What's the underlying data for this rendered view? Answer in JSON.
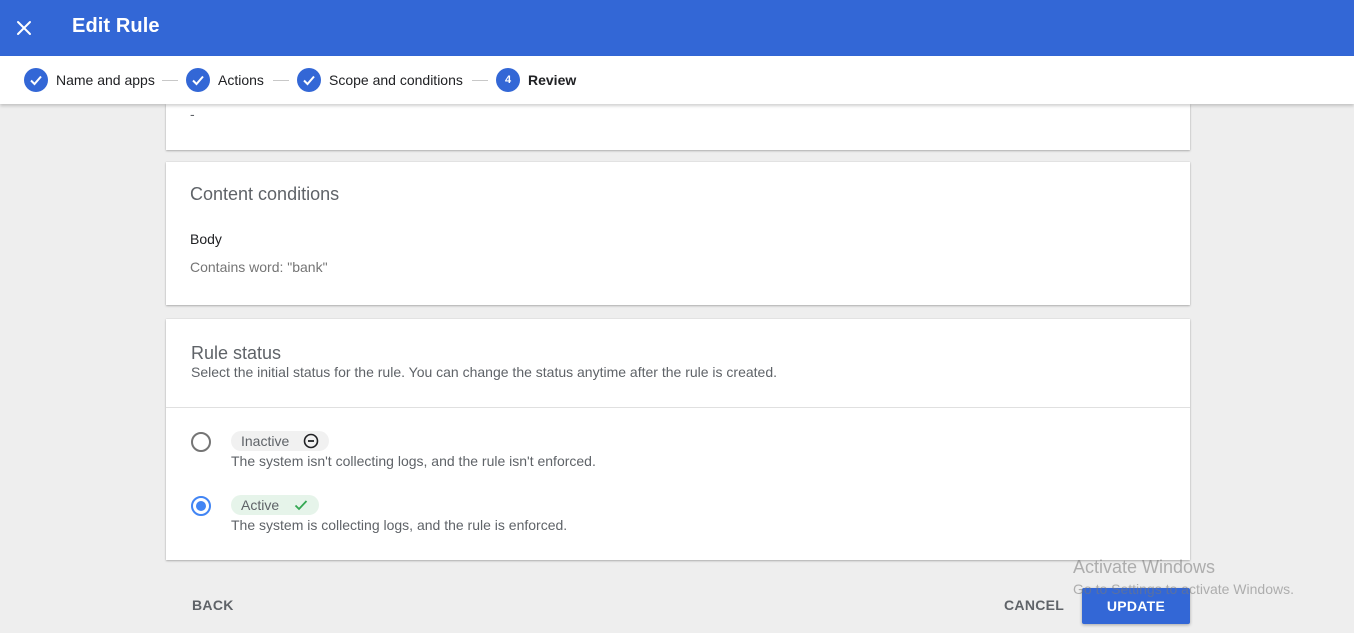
{
  "header": {
    "close_icon": "close-icon",
    "title": "Edit Rule",
    "bg_color": "#3367d6"
  },
  "stepper": {
    "steps": [
      {
        "label": "Name and apps",
        "state": "complete",
        "icon": "check-icon"
      },
      {
        "label": "Actions",
        "state": "complete",
        "icon": "check-icon"
      },
      {
        "label": "Scope and conditions",
        "state": "complete",
        "icon": "check-icon"
      },
      {
        "label": "Review",
        "state": "current",
        "number": "4"
      }
    ]
  },
  "previous_section": {
    "value": "-"
  },
  "content_conditions": {
    "title": "Content conditions",
    "field": "Body",
    "condition": "Contains word: \"bank\""
  },
  "rule_status": {
    "title": "Rule status",
    "description": "Select the initial status for the rule. You can change the status anytime after the rule is created.",
    "options": [
      {
        "label": "Inactive",
        "icon": "minus-circle-icon",
        "description": "The system isn't collecting logs, and the rule isn't enforced.",
        "selected": false
      },
      {
        "label": "Active",
        "icon": "check-icon",
        "description": "The system is collecting logs, and the rule is enforced.",
        "selected": true
      }
    ]
  },
  "footer": {
    "back_label": "BACK",
    "cancel_label": "CANCEL",
    "update_label": "UPDATE"
  },
  "watermark": {
    "line1": "Activate Windows",
    "line2": "Go to Settings to activate Windows."
  },
  "colors": {
    "primary": "#3367d6",
    "radio_selected": "#4285f4",
    "active_chip_bg": "#e6f4ea",
    "active_check": "#34a853"
  }
}
